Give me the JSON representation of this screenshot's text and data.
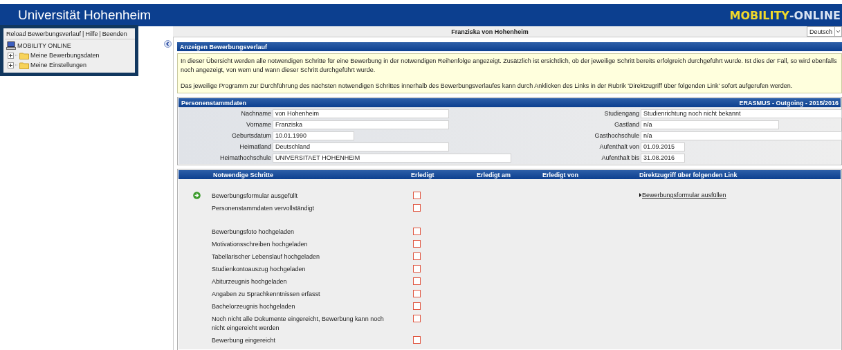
{
  "header": {
    "title": "Universität Hohenheim",
    "logo_left": "MOBILITY",
    "logo_sep": "-",
    "logo_right": "ONLINE"
  },
  "menu": {
    "links": [
      "Reload Bewerbungsverlauf",
      "Hilfe",
      "Beenden"
    ],
    "separators": [
      "|",
      "|"
    ],
    "tree": {
      "label": "MOBILITY ONLINE",
      "children": [
        {
          "label": "Meine Bewerbungsdaten",
          "expanded": false
        },
        {
          "label": "Meine Einstellungen",
          "expanded": false
        }
      ]
    }
  },
  "topbar": {
    "user": "Franziska von Hohenheim",
    "language": "Deutsch"
  },
  "overview": {
    "title": "Anzeigen Bewerbungsverlauf",
    "paragraphs": [
      "In dieser Übersicht werden alle notwendigen Schritte für eine Bewerbung in der notwendigen Reihenfolge angezeigt. Zusätzlich ist ersichtlich, ob der jeweilige Schritt bereits erfolgreich durchgeführt wurde. Ist dies der Fall, so wird ebenfalls noch angezeigt, von wem und wann dieser Schritt durchgeführt wurde.",
      "Das jeweilige Programm zur Durchführung des nächsten notwendigen Schrittes innerhalb des Bewerbungsverlaufes kann durch Anklicken des Links in der Rubrik 'Direktzugriff über folgenden Link' sofort aufgerufen werden."
    ]
  },
  "person": {
    "title": "Personenstammdaten",
    "program": "ERASMUS - Outgoing - 2015/2016",
    "left": [
      {
        "label": "Nachname",
        "value": "von Hohenheim",
        "kind": "text"
      },
      {
        "label": "Vorname",
        "value": "Franziska",
        "kind": "text"
      },
      {
        "label": "Geburtsdatum",
        "value": "10.01.1990",
        "kind": "date"
      },
      {
        "label": "Heimatland",
        "value": "Deutschland",
        "kind": "text"
      },
      {
        "label": "Heimathochschule",
        "value": "UNIVERSITAET HOHENHEIM",
        "kind": "long"
      }
    ],
    "right": [
      {
        "label": "Studiengang",
        "value": "Studienrichtung noch nicht bekannt",
        "kind": "full"
      },
      {
        "label": "Gastland",
        "value": "n/a",
        "kind": "long"
      },
      {
        "label": "Gasthochschule",
        "value": "n/a",
        "kind": "full"
      },
      {
        "label": "Aufenthalt von",
        "value": "01.09.2015",
        "kind": "date"
      },
      {
        "label": "Aufenthalt bis",
        "value": "31.08.2016",
        "kind": "date"
      }
    ]
  },
  "steps": {
    "columns": [
      "Notwendige Schritte",
      "Erledigt",
      "Erledigt am",
      "Erledigt von",
      "Direktzugriff über folgenden Link"
    ],
    "groups": [
      [
        {
          "label": "Bewerbungsformular ausgefüllt",
          "current": true,
          "done": false,
          "link": "Bewerbungsformular ausfüllen"
        },
        {
          "label": "Personenstammdaten vervollständigt",
          "current": false,
          "done": false
        }
      ],
      [
        {
          "label": "Bewerbungsfoto hochgeladen",
          "current": false,
          "done": false
        },
        {
          "label": "Motivationsschreiben hochgeladen",
          "current": false,
          "done": false
        },
        {
          "label": "Tabellarischer Lebenslauf hochgeladen",
          "current": false,
          "done": false
        },
        {
          "label": "Studienkontoauszug hochgeladen",
          "current": false,
          "done": false
        },
        {
          "label": "Abiturzeugnis hochgeladen",
          "current": false,
          "done": false
        },
        {
          "label": "Angaben zu Sprachkenntnissen erfasst",
          "current": false,
          "done": false
        },
        {
          "label": "Bachelorzeugnis hochgeladen",
          "current": false,
          "done": false
        },
        {
          "label": "Noch nicht alle Dokumente eingereicht, Bewerbung kann noch nicht eingereicht werden",
          "current": false,
          "done": false
        },
        {
          "label": "Bewerbung eingereicht",
          "current": false,
          "done": false
        }
      ]
    ]
  }
}
